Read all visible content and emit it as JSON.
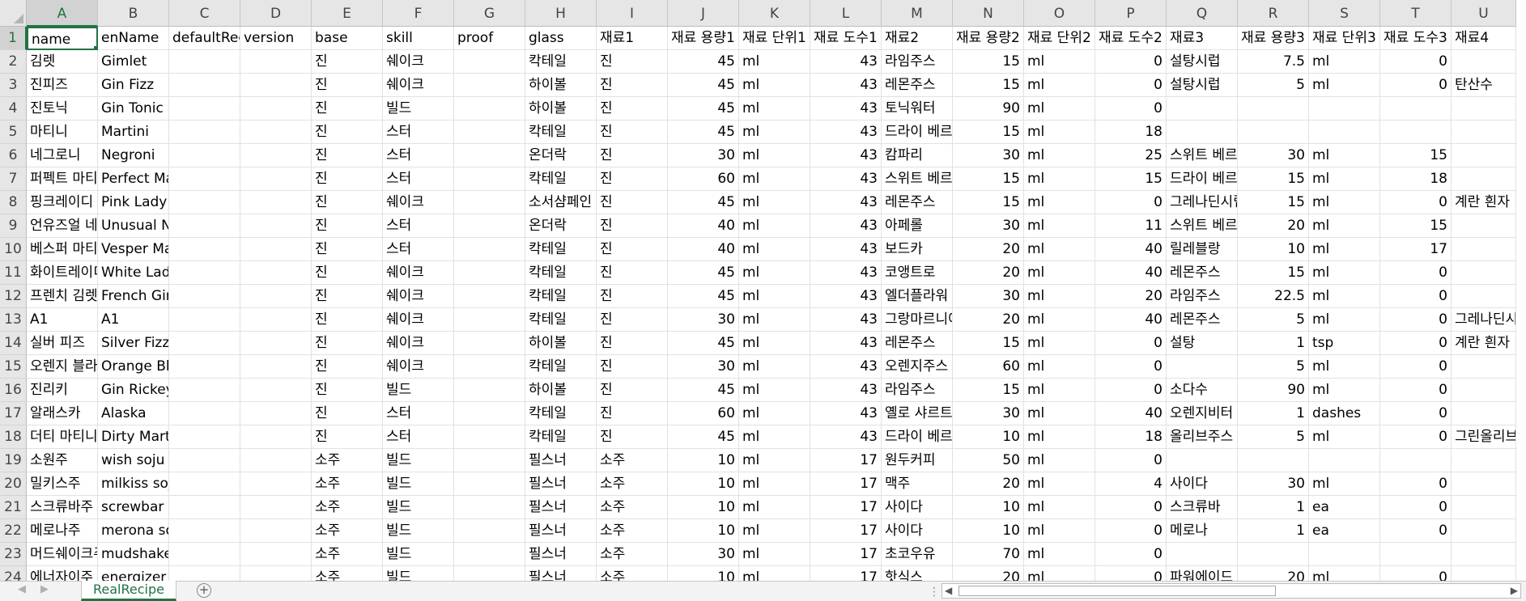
{
  "spreadsheet": {
    "active_cell": "A1",
    "columns": [
      "A",
      "B",
      "C",
      "D",
      "E",
      "F",
      "G",
      "H",
      "I",
      "J",
      "K",
      "L",
      "M",
      "N",
      "O",
      "P",
      "Q",
      "R",
      "S",
      "T",
      "U"
    ],
    "numeric_columns": [
      9,
      11,
      13,
      15,
      17,
      19
    ],
    "rows": [
      {
        "n": "1",
        "c": [
          "name",
          "enName",
          "defaultRecipe",
          "version",
          "base",
          "skill",
          "proof",
          "glass",
          "재료1",
          "재료 용량1",
          "재료 단위1",
          "재료 도수1",
          "재료2",
          "재료 용량2",
          "재료 단위2",
          "재료 도수2",
          "재료3",
          "재료 용량3",
          "재료 단위3",
          "재료 도수3",
          "재료4"
        ]
      },
      {
        "n": "2",
        "c": [
          "김렛",
          "Gimlet",
          "",
          "",
          "진",
          "쉐이크",
          "",
          "칵테일",
          "진",
          "45",
          "ml",
          "43",
          "라임주스",
          "15",
          "ml",
          "0",
          "설탕시럽",
          "7.5",
          "ml",
          "0",
          ""
        ]
      },
      {
        "n": "3",
        "c": [
          "진피즈",
          "Gin Fizz",
          "",
          "",
          "진",
          "쉐이크",
          "",
          "하이볼",
          "진",
          "45",
          "ml",
          "43",
          "레몬주스",
          "15",
          "ml",
          "0",
          "설탕시럽",
          "5",
          "ml",
          "0",
          "탄산수"
        ]
      },
      {
        "n": "4",
        "c": [
          "진토닉",
          "Gin Tonic",
          "",
          "",
          "진",
          "빌드",
          "",
          "하이볼",
          "진",
          "45",
          "ml",
          "43",
          "토닉워터",
          "90",
          "ml",
          "0",
          "",
          "",
          "",
          "",
          ""
        ]
      },
      {
        "n": "5",
        "c": [
          "마티니",
          "Martini",
          "",
          "",
          "진",
          "스터",
          "",
          "칵테일",
          "진",
          "45",
          "ml",
          "43",
          "드라이 베르무트",
          "15",
          "ml",
          "18",
          "",
          "",
          "",
          "",
          ""
        ]
      },
      {
        "n": "6",
        "c": [
          "네그로니",
          "Negroni",
          "",
          "",
          "진",
          "스터",
          "",
          "온더락",
          "진",
          "30",
          "ml",
          "43",
          "캄파리",
          "30",
          "ml",
          "25",
          "스위트 베르무트",
          "30",
          "ml",
          "15",
          ""
        ]
      },
      {
        "n": "7",
        "c": [
          "퍼펙트 마티니",
          "Perfect Martini",
          "",
          "",
          "진",
          "스터",
          "",
          "칵테일",
          "진",
          "60",
          "ml",
          "43",
          "스위트 베르무트",
          "15",
          "ml",
          "15",
          "드라이 베르무트",
          "15",
          "ml",
          "18",
          ""
        ]
      },
      {
        "n": "8",
        "c": [
          "핑크레이디",
          "Pink Lady",
          "",
          "",
          "진",
          "쉐이크",
          "",
          "소서샴페인",
          "진",
          "45",
          "ml",
          "43",
          "레몬주스",
          "15",
          "ml",
          "0",
          "그레나딘시럽",
          "15",
          "ml",
          "0",
          "계란 흰자"
        ]
      },
      {
        "n": "9",
        "c": [
          "언유즈얼 네그로니",
          "Unusual Negroni",
          "",
          "",
          "진",
          "스터",
          "",
          "온더락",
          "진",
          "40",
          "ml",
          "43",
          "아페롤",
          "30",
          "ml",
          "11",
          "스위트 베르무트",
          "20",
          "ml",
          "15",
          ""
        ]
      },
      {
        "n": "10",
        "c": [
          "베스퍼 마티니",
          "Vesper Martini",
          "",
          "",
          "진",
          "스터",
          "",
          "칵테일",
          "진",
          "40",
          "ml",
          "43",
          "보드카",
          "20",
          "ml",
          "40",
          "릴레블랑",
          "10",
          "ml",
          "17",
          ""
        ]
      },
      {
        "n": "11",
        "c": [
          "화이트레이디",
          "White Lady",
          "",
          "",
          "진",
          "쉐이크",
          "",
          "칵테일",
          "진",
          "45",
          "ml",
          "43",
          "코앵트로",
          "20",
          "ml",
          "40",
          "레몬주스",
          "15",
          "ml",
          "0",
          ""
        ]
      },
      {
        "n": "12",
        "c": [
          "프렌치 김렛",
          "French Gimlet",
          "",
          "",
          "진",
          "쉐이크",
          "",
          "칵테일",
          "진",
          "45",
          "ml",
          "43",
          "엘더플라워",
          "30",
          "ml",
          "20",
          "라임주스",
          "22.5",
          "ml",
          "0",
          ""
        ]
      },
      {
        "n": "13",
        "c": [
          "A1",
          "A1",
          "",
          "",
          "진",
          "쉐이크",
          "",
          "칵테일",
          "진",
          "30",
          "ml",
          "43",
          "그랑마르니에",
          "20",
          "ml",
          "40",
          "레몬주스",
          "5",
          "ml",
          "0",
          "그레나딘시럽"
        ]
      },
      {
        "n": "14",
        "c": [
          "실버 피즈",
          "Silver Fizz",
          "",
          "",
          "진",
          "쉐이크",
          "",
          "하이볼",
          "진",
          "45",
          "ml",
          "43",
          "레몬주스",
          "15",
          "ml",
          "0",
          "설탕",
          "1",
          "tsp",
          "0",
          "계란 흰자"
        ]
      },
      {
        "n": "15",
        "c": [
          "오렌지 블라썸",
          "Orange Blossom",
          "",
          "",
          "진",
          "쉐이크",
          "",
          "칵테일",
          "진",
          "30",
          "ml",
          "43",
          "오렌지주스",
          "60",
          "ml",
          "0",
          "",
          "5",
          "ml",
          "0",
          ""
        ]
      },
      {
        "n": "16",
        "c": [
          "진리키",
          "Gin Rickey",
          "",
          "",
          "진",
          "빌드",
          "",
          "하이볼",
          "진",
          "45",
          "ml",
          "43",
          "라임주스",
          "15",
          "ml",
          "0",
          "소다수",
          "90",
          "ml",
          "0",
          ""
        ]
      },
      {
        "n": "17",
        "c": [
          "알래스카",
          "Alaska",
          "",
          "",
          "진",
          "스터",
          "",
          "칵테일",
          "진",
          "60",
          "ml",
          "43",
          "옐로 샤르트뢰즈",
          "30",
          "ml",
          "40",
          "오렌지비터",
          "1",
          "dashes",
          "0",
          ""
        ]
      },
      {
        "n": "18",
        "c": [
          "더티 마티니",
          "Dirty Martini",
          "",
          "",
          "진",
          "스터",
          "",
          "칵테일",
          "진",
          "45",
          "ml",
          "43",
          "드라이 베르무트",
          "10",
          "ml",
          "18",
          "올리브주스",
          "5",
          "ml",
          "0",
          "그린올리브"
        ]
      },
      {
        "n": "19",
        "c": [
          "소원주",
          "wish soju",
          "",
          "",
          "소주",
          "빌드",
          "",
          "필스너",
          "소주",
          "10",
          "ml",
          "17",
          "원두커피",
          "50",
          "ml",
          "0",
          "",
          "",
          "",
          "",
          ""
        ]
      },
      {
        "n": "20",
        "c": [
          "밀키스주",
          "milkiss soju",
          "",
          "",
          "소주",
          "빌드",
          "",
          "필스너",
          "소주",
          "10",
          "ml",
          "17",
          "맥주",
          "20",
          "ml",
          "4",
          "사이다",
          "30",
          "ml",
          "0",
          ""
        ]
      },
      {
        "n": "21",
        "c": [
          "스크류바주",
          "screwbar soju",
          "",
          "",
          "소주",
          "빌드",
          "",
          "필스너",
          "소주",
          "10",
          "ml",
          "17",
          "사이다",
          "10",
          "ml",
          "0",
          "스크류바",
          "1",
          "ea",
          "0",
          ""
        ]
      },
      {
        "n": "22",
        "c": [
          "메로나주",
          "merona soju",
          "",
          "",
          "소주",
          "빌드",
          "",
          "필스너",
          "소주",
          "10",
          "ml",
          "17",
          "사이다",
          "10",
          "ml",
          "0",
          "메로나",
          "1",
          "ea",
          "0",
          ""
        ]
      },
      {
        "n": "23",
        "c": [
          "머드쉐이크주",
          "mudshake soju",
          "",
          "",
          "소주",
          "빌드",
          "",
          "필스너",
          "소주",
          "30",
          "ml",
          "17",
          "초코우유",
          "70",
          "ml",
          "0",
          "",
          "",
          "",
          "",
          ""
        ]
      },
      {
        "n": "24",
        "c": [
          "에너자이주",
          "energizer soju",
          "",
          "",
          "소주",
          "빌드",
          "",
          "필스너",
          "소주",
          "10",
          "ml",
          "17",
          "핫식스",
          "20",
          "ml",
          "0",
          "파워에이드",
          "20",
          "ml",
          "0",
          ""
        ]
      }
    ]
  },
  "sheet_tabs": {
    "active": "RealRecipe",
    "add_label": "+",
    "prev_icon": "triangle-left-icon",
    "next_icon": "triangle-right-icon"
  },
  "scrollbar": {
    "left_arrow": "◀",
    "right_arrow": "▶",
    "splitter": "⋮"
  }
}
